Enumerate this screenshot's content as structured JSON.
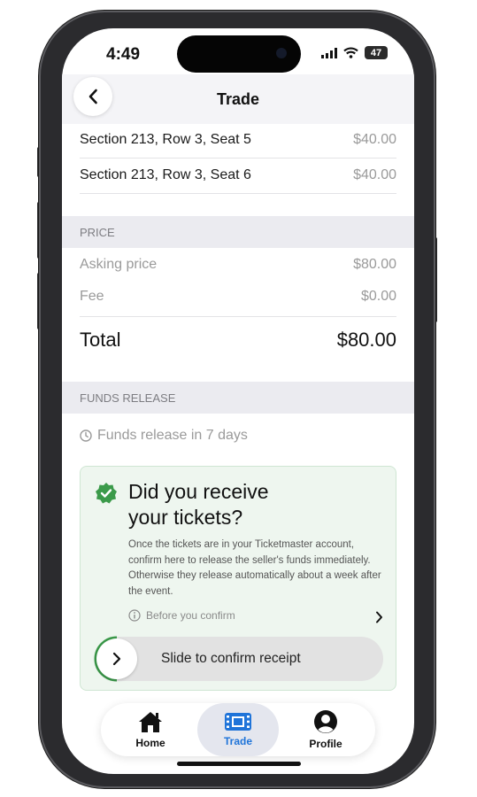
{
  "status": {
    "time": "4:49",
    "battery": "47"
  },
  "nav": {
    "title": "Trade"
  },
  "tickets": [
    {
      "seat": "Section 213, Row 3, Seat 5",
      "price": "$40.00"
    },
    {
      "seat": "Section 213, Row 3, Seat 6",
      "price": "$40.00"
    }
  ],
  "price": {
    "header": "PRICE",
    "asking_label": "Asking price",
    "asking_value": "$80.00",
    "fee_label": "Fee",
    "fee_value": "$0.00",
    "total_label": "Total",
    "total_value": "$80.00"
  },
  "funds": {
    "header": "FUNDS RELEASE",
    "release_text": "Funds release in 7 days"
  },
  "card": {
    "title": "Did you receive your tickets?",
    "body": "Once the tickets are in your Ticketmaster account, confirm here to release the seller's funds immediately. Otherwise they release automatically about a week after the event.",
    "before_label": "Before you confirm",
    "slider_label": "Slide to confirm receipt"
  },
  "tabs": [
    {
      "label": "Home",
      "icon": "home-icon"
    },
    {
      "label": "Trade",
      "icon": "ticket-icon",
      "active": true
    },
    {
      "label": "Profile",
      "icon": "profile-icon"
    }
  ],
  "colors": {
    "accent": "#1f74d9",
    "success": "#3b9a4a"
  }
}
